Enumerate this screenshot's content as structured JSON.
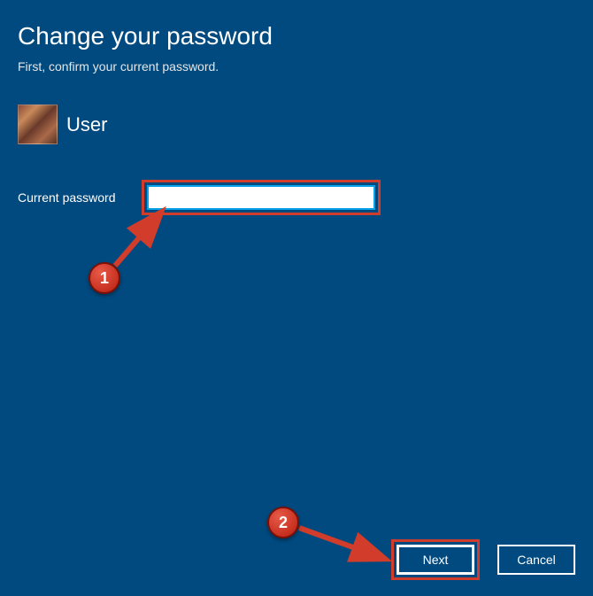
{
  "header": {
    "title": "Change your password",
    "subtitle": "First, confirm your current password."
  },
  "user": {
    "name": "User"
  },
  "form": {
    "current_password_label": "Current password",
    "current_password_value": ""
  },
  "buttons": {
    "next": "Next",
    "cancel": "Cancel"
  },
  "annotations": {
    "marker1": "1",
    "marker2": "2"
  },
  "colors": {
    "background": "#004a7f",
    "highlight": "#d23c2a",
    "input_border": "#05a0e8"
  }
}
